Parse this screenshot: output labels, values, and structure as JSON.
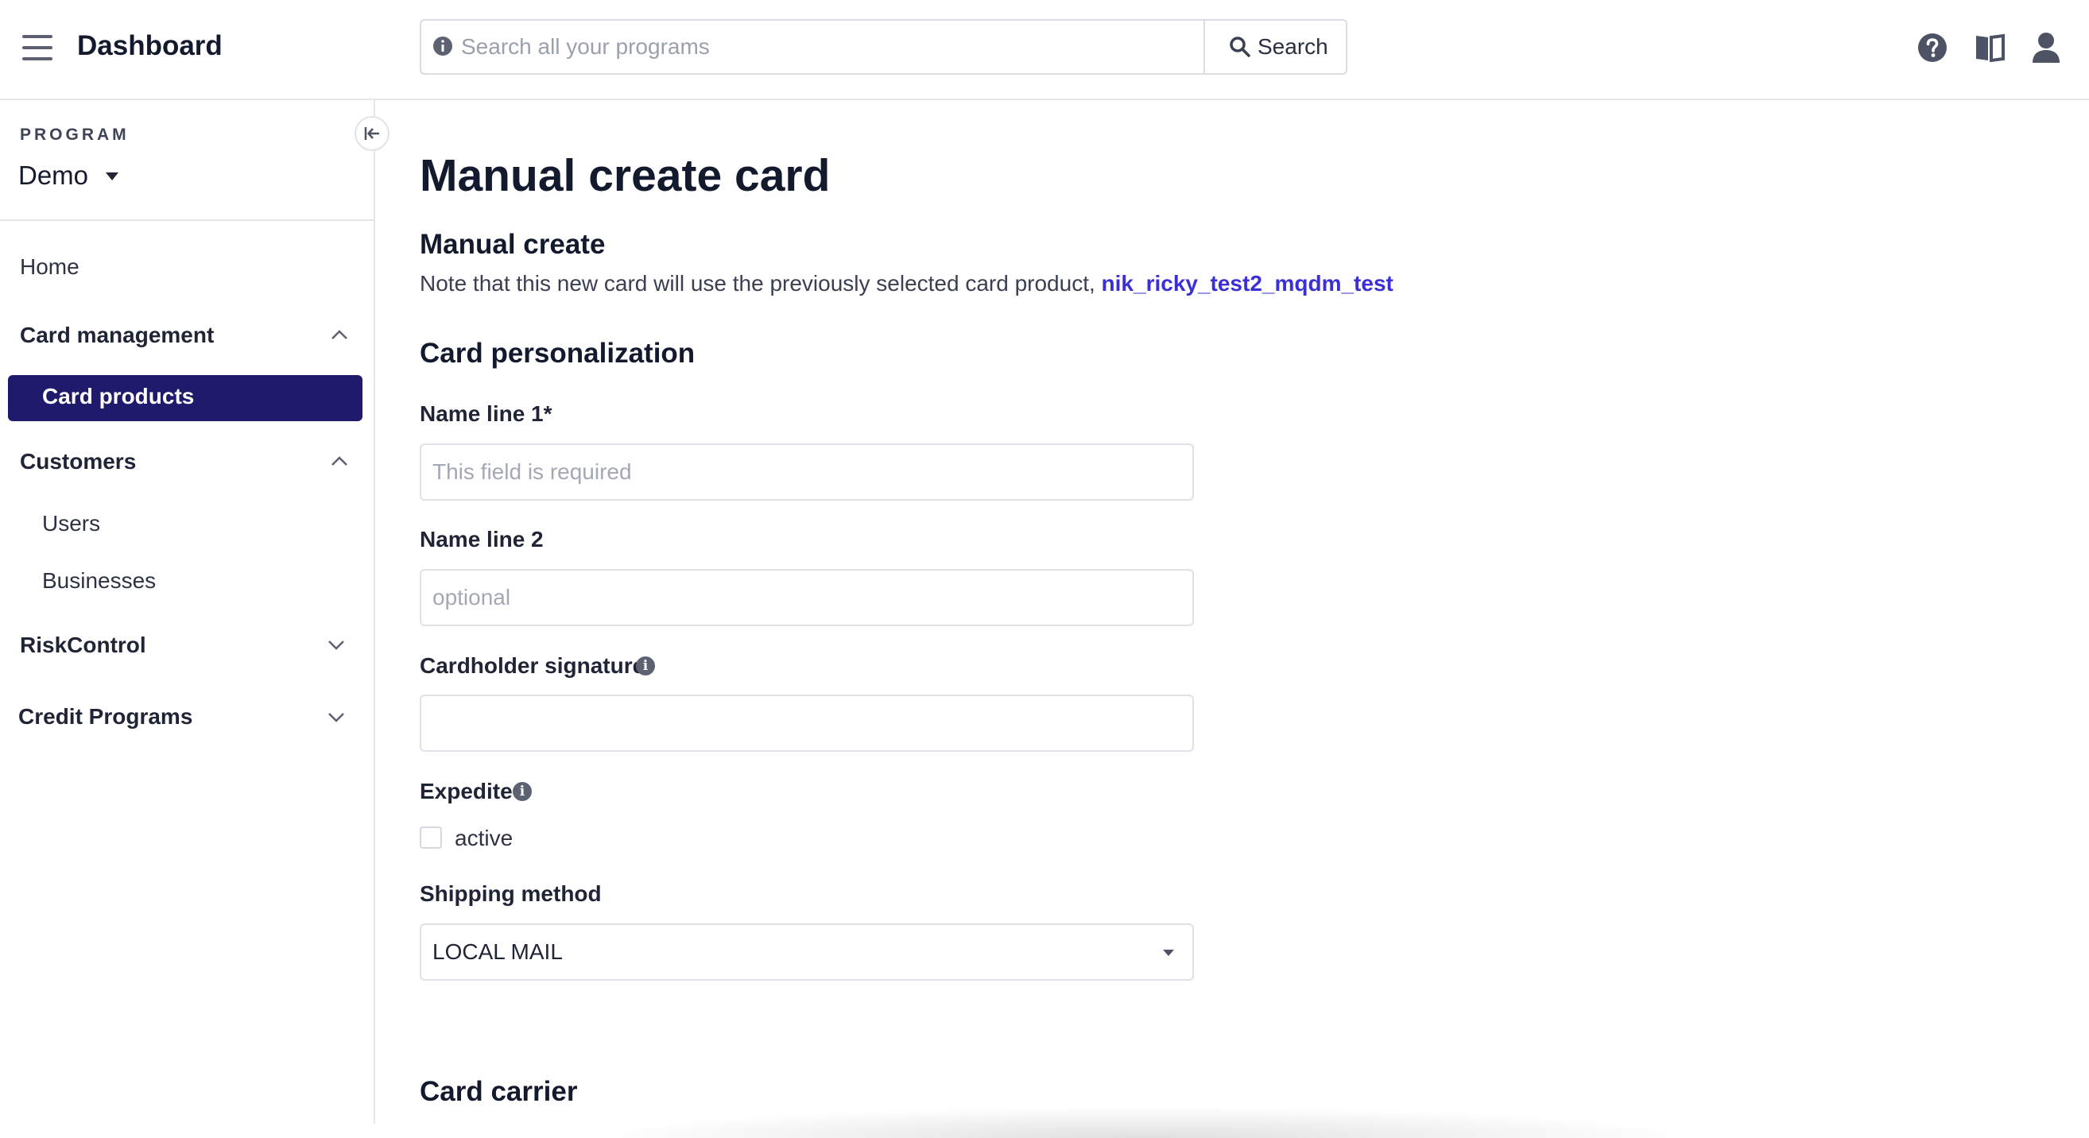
{
  "header": {
    "title": "Dashboard",
    "search_placeholder": "Search all your programs",
    "search_button": "Search",
    "icons": [
      "menu-icon",
      "help-icon",
      "book-icon",
      "user-icon"
    ]
  },
  "sidebar": {
    "program_label": "PROGRAM",
    "program_name": "Demo",
    "items": [
      {
        "label": "Home"
      },
      {
        "label": "Card management",
        "expanded": true
      },
      {
        "label": "Card products",
        "selected": true
      },
      {
        "label": "Customers",
        "expanded": true
      },
      {
        "label": "Users"
      },
      {
        "label": "Businesses"
      },
      {
        "label": "RiskControl",
        "expanded": false
      },
      {
        "label": "Credit Programs",
        "expanded": false
      }
    ]
  },
  "main": {
    "page_title": "Manual create card",
    "section_title": "Manual create",
    "note": "Note that this new card will use the previously selected card product,",
    "card_product_link": "nik_ricky_test2_mqdm_test",
    "personalization_title": "Card personalization",
    "fields": {
      "name_line_1": {
        "label": "Name line 1*",
        "placeholder": "This field is required",
        "value": ""
      },
      "name_line_2": {
        "label": "Name line 2",
        "placeholder": "optional",
        "value": ""
      },
      "signature": {
        "label": "Cardholder signature",
        "value": ""
      },
      "expedite": {
        "label": "Expedite",
        "checkbox_label": "active",
        "checked": false
      },
      "shipping_method": {
        "label": "Shipping method",
        "selected": "LOCAL MAIL"
      }
    },
    "card_carrier_title": "Card carrier"
  },
  "colors": {
    "accent": "#1f1a6b",
    "link": "#3b2fd6"
  }
}
